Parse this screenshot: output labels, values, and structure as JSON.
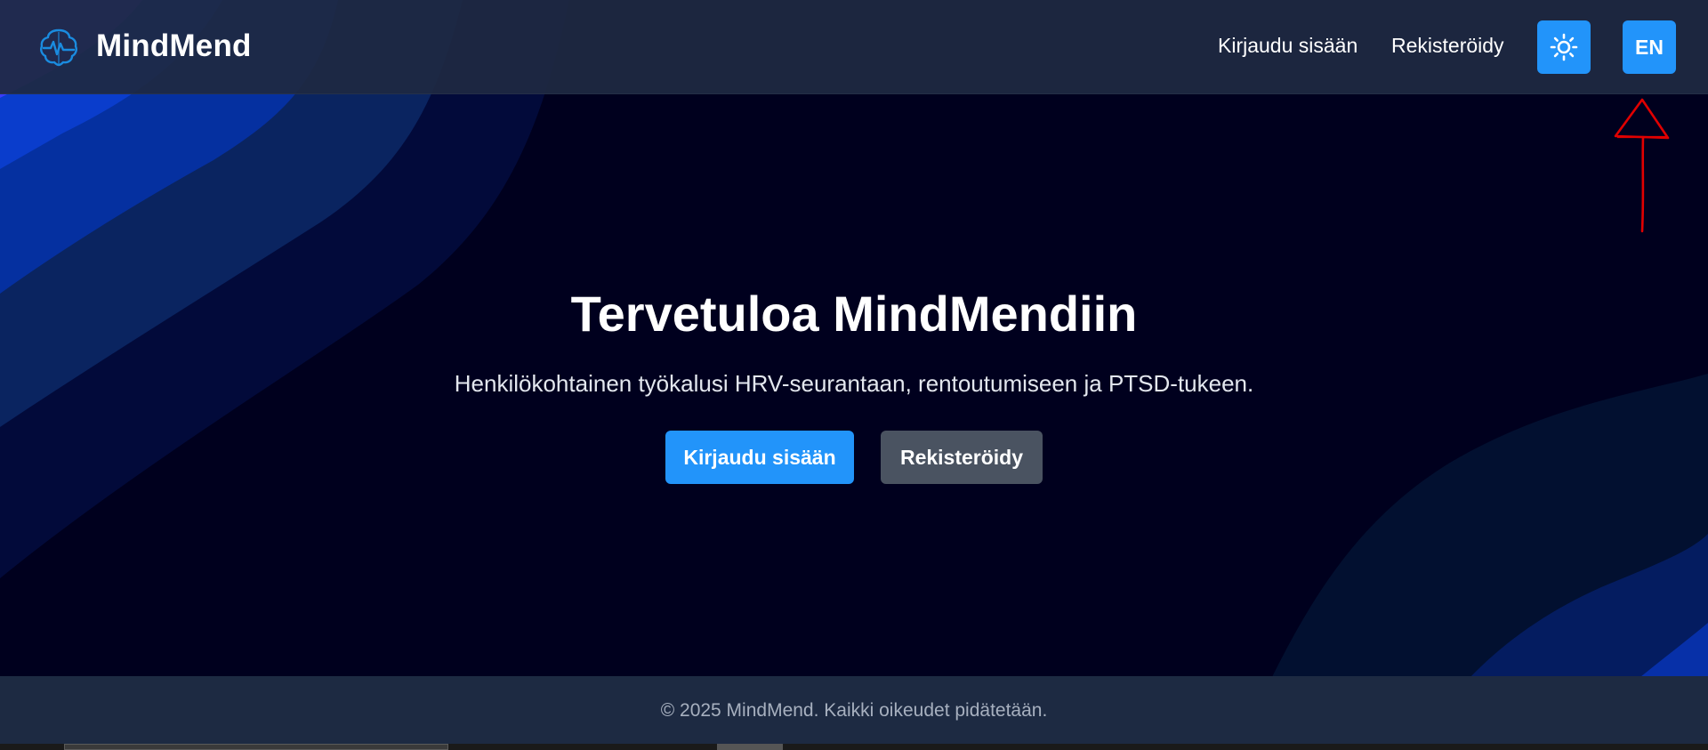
{
  "brand": {
    "name": "MindMend",
    "icon": "brain-heartbeat-icon"
  },
  "nav": {
    "login_label": "Kirjaudu sisään",
    "register_label": "Rekisteröidy",
    "theme_icon": "sun-icon",
    "language_label": "EN"
  },
  "hero": {
    "title": "Tervetuloa MindMendiin",
    "subtitle": "Henkilökohtainen työkalusi HRV-seurantaan, rentoutumiseen ja PTSD-tukeen.",
    "primary_button": "Kirjaudu sisään",
    "secondary_button": "Rekisteröidy"
  },
  "footer": {
    "text": "© 2025 MindMend. Kaikki oikeudet pidätetään."
  },
  "colors": {
    "accent": "#2294fa",
    "background": "#00001e",
    "navbar": "#1e2942",
    "secondary_button": "#4a5361",
    "annotation": "#e00000"
  }
}
